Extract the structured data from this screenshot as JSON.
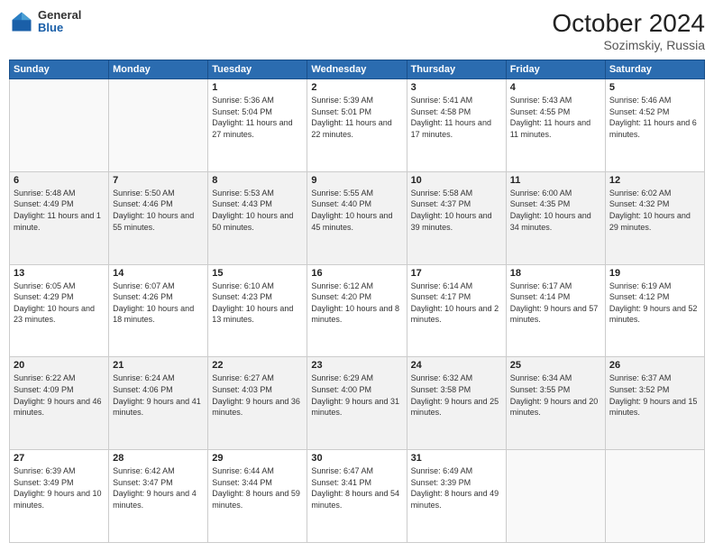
{
  "header": {
    "logo": {
      "general": "General",
      "blue": "Blue"
    },
    "title": "October 2024",
    "location": "Sozimskiy, Russia"
  },
  "calendar": {
    "days_of_week": [
      "Sunday",
      "Monday",
      "Tuesday",
      "Wednesday",
      "Thursday",
      "Friday",
      "Saturday"
    ],
    "weeks": [
      [
        {
          "day": "",
          "info": ""
        },
        {
          "day": "",
          "info": ""
        },
        {
          "day": "1",
          "info": "Sunrise: 5:36 AM\nSunset: 5:04 PM\nDaylight: 11 hours and 27 minutes."
        },
        {
          "day": "2",
          "info": "Sunrise: 5:39 AM\nSunset: 5:01 PM\nDaylight: 11 hours and 22 minutes."
        },
        {
          "day": "3",
          "info": "Sunrise: 5:41 AM\nSunset: 4:58 PM\nDaylight: 11 hours and 17 minutes."
        },
        {
          "day": "4",
          "info": "Sunrise: 5:43 AM\nSunset: 4:55 PM\nDaylight: 11 hours and 11 minutes."
        },
        {
          "day": "5",
          "info": "Sunrise: 5:46 AM\nSunset: 4:52 PM\nDaylight: 11 hours and 6 minutes."
        }
      ],
      [
        {
          "day": "6",
          "info": "Sunrise: 5:48 AM\nSunset: 4:49 PM\nDaylight: 11 hours and 1 minute."
        },
        {
          "day": "7",
          "info": "Sunrise: 5:50 AM\nSunset: 4:46 PM\nDaylight: 10 hours and 55 minutes."
        },
        {
          "day": "8",
          "info": "Sunrise: 5:53 AM\nSunset: 4:43 PM\nDaylight: 10 hours and 50 minutes."
        },
        {
          "day": "9",
          "info": "Sunrise: 5:55 AM\nSunset: 4:40 PM\nDaylight: 10 hours and 45 minutes."
        },
        {
          "day": "10",
          "info": "Sunrise: 5:58 AM\nSunset: 4:37 PM\nDaylight: 10 hours and 39 minutes."
        },
        {
          "day": "11",
          "info": "Sunrise: 6:00 AM\nSunset: 4:35 PM\nDaylight: 10 hours and 34 minutes."
        },
        {
          "day": "12",
          "info": "Sunrise: 6:02 AM\nSunset: 4:32 PM\nDaylight: 10 hours and 29 minutes."
        }
      ],
      [
        {
          "day": "13",
          "info": "Sunrise: 6:05 AM\nSunset: 4:29 PM\nDaylight: 10 hours and 23 minutes."
        },
        {
          "day": "14",
          "info": "Sunrise: 6:07 AM\nSunset: 4:26 PM\nDaylight: 10 hours and 18 minutes."
        },
        {
          "day": "15",
          "info": "Sunrise: 6:10 AM\nSunset: 4:23 PM\nDaylight: 10 hours and 13 minutes."
        },
        {
          "day": "16",
          "info": "Sunrise: 6:12 AM\nSunset: 4:20 PM\nDaylight: 10 hours and 8 minutes."
        },
        {
          "day": "17",
          "info": "Sunrise: 6:14 AM\nSunset: 4:17 PM\nDaylight: 10 hours and 2 minutes."
        },
        {
          "day": "18",
          "info": "Sunrise: 6:17 AM\nSunset: 4:14 PM\nDaylight: 9 hours and 57 minutes."
        },
        {
          "day": "19",
          "info": "Sunrise: 6:19 AM\nSunset: 4:12 PM\nDaylight: 9 hours and 52 minutes."
        }
      ],
      [
        {
          "day": "20",
          "info": "Sunrise: 6:22 AM\nSunset: 4:09 PM\nDaylight: 9 hours and 46 minutes."
        },
        {
          "day": "21",
          "info": "Sunrise: 6:24 AM\nSunset: 4:06 PM\nDaylight: 9 hours and 41 minutes."
        },
        {
          "day": "22",
          "info": "Sunrise: 6:27 AM\nSunset: 4:03 PM\nDaylight: 9 hours and 36 minutes."
        },
        {
          "day": "23",
          "info": "Sunrise: 6:29 AM\nSunset: 4:00 PM\nDaylight: 9 hours and 31 minutes."
        },
        {
          "day": "24",
          "info": "Sunrise: 6:32 AM\nSunset: 3:58 PM\nDaylight: 9 hours and 25 minutes."
        },
        {
          "day": "25",
          "info": "Sunrise: 6:34 AM\nSunset: 3:55 PM\nDaylight: 9 hours and 20 minutes."
        },
        {
          "day": "26",
          "info": "Sunrise: 6:37 AM\nSunset: 3:52 PM\nDaylight: 9 hours and 15 minutes."
        }
      ],
      [
        {
          "day": "27",
          "info": "Sunrise: 6:39 AM\nSunset: 3:49 PM\nDaylight: 9 hours and 10 minutes."
        },
        {
          "day": "28",
          "info": "Sunrise: 6:42 AM\nSunset: 3:47 PM\nDaylight: 9 hours and 4 minutes."
        },
        {
          "day": "29",
          "info": "Sunrise: 6:44 AM\nSunset: 3:44 PM\nDaylight: 8 hours and 59 minutes."
        },
        {
          "day": "30",
          "info": "Sunrise: 6:47 AM\nSunset: 3:41 PM\nDaylight: 8 hours and 54 minutes."
        },
        {
          "day": "31",
          "info": "Sunrise: 6:49 AM\nSunset: 3:39 PM\nDaylight: 8 hours and 49 minutes."
        },
        {
          "day": "",
          "info": ""
        },
        {
          "day": "",
          "info": ""
        }
      ]
    ]
  }
}
